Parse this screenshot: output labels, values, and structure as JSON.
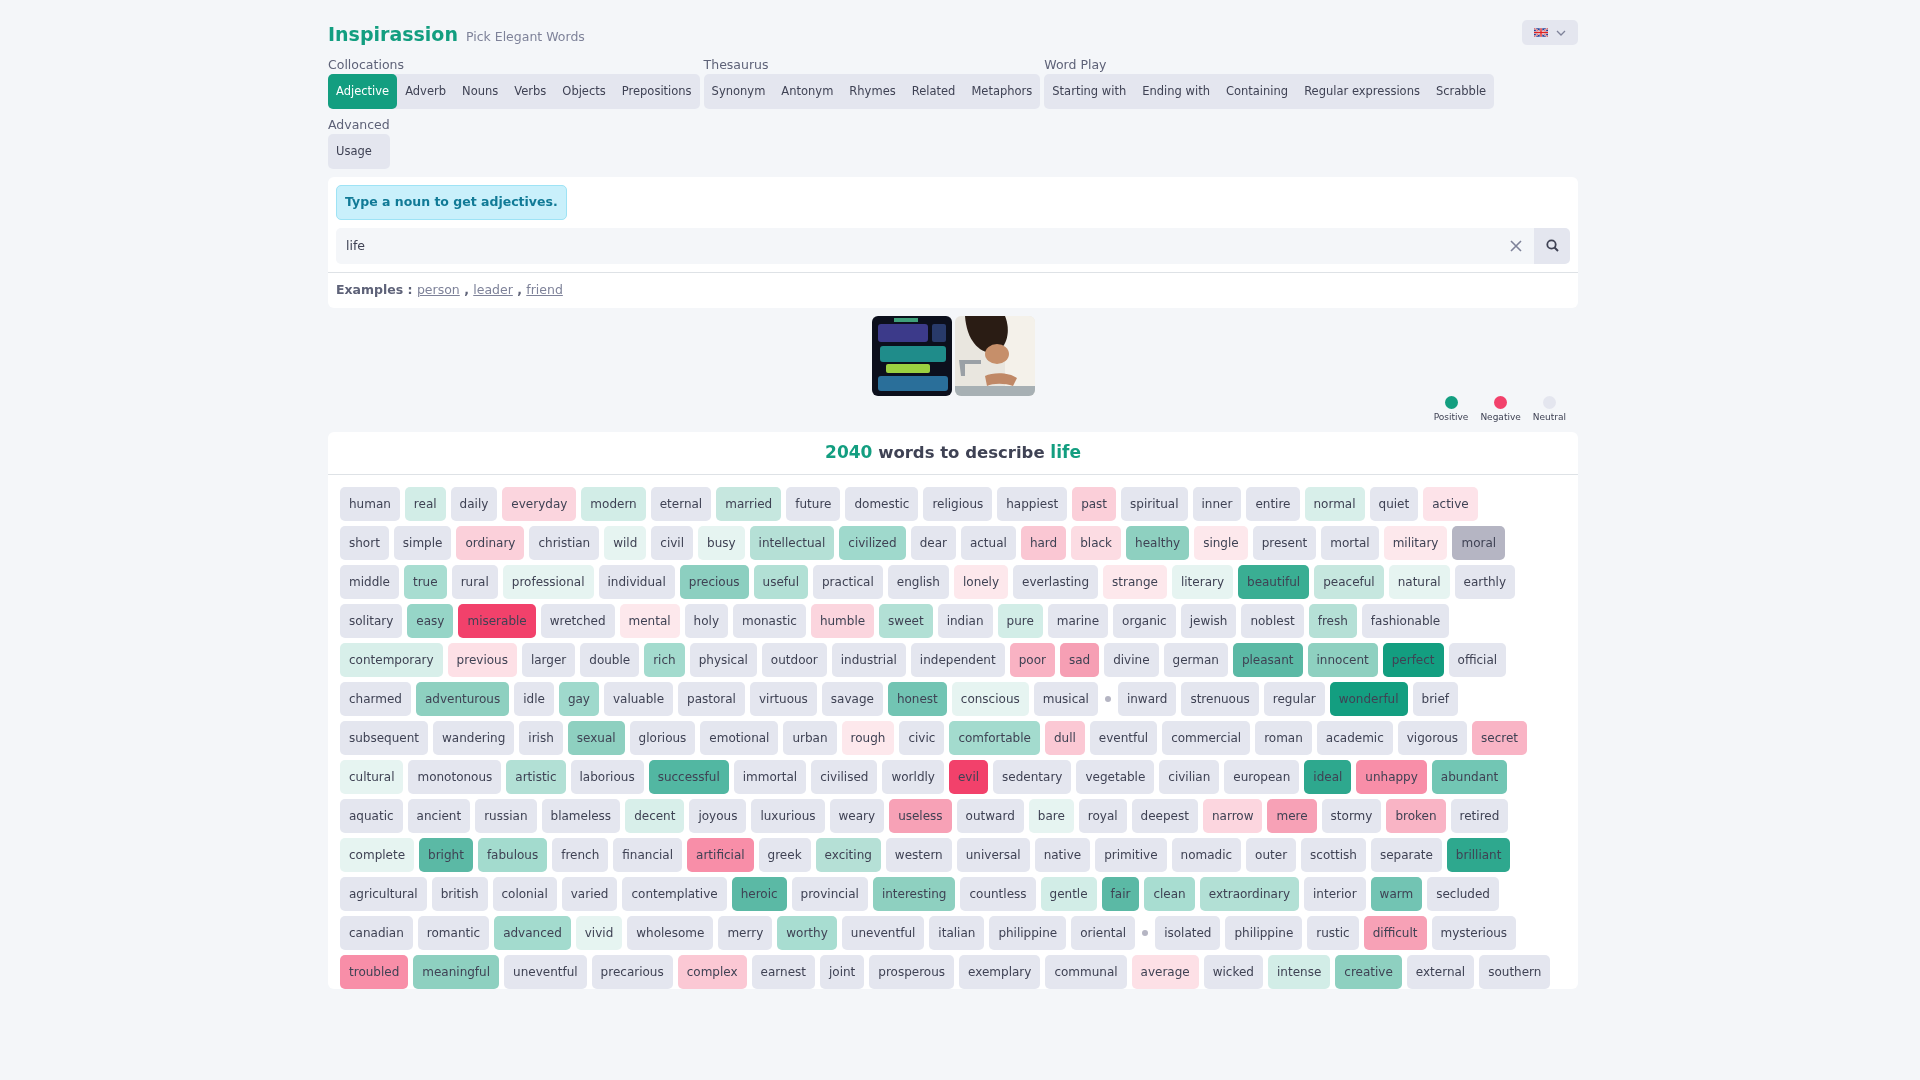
{
  "brand": {
    "name": "Inspirassion",
    "tagline": "Pick Elegant Words"
  },
  "tab_groups": [
    {
      "label": "Collocations",
      "tabs": [
        {
          "label": "Adjective",
          "selected": true
        },
        {
          "label": "Adverb",
          "selected": false
        },
        {
          "label": "Nouns",
          "selected": false
        },
        {
          "label": "Verbs",
          "selected": false
        },
        {
          "label": "Objects",
          "selected": false
        },
        {
          "label": "Prepositions",
          "selected": false
        }
      ]
    },
    {
      "label": "Thesaurus",
      "tabs": [
        {
          "label": "Synonym",
          "selected": false
        },
        {
          "label": "Antonym",
          "selected": false
        },
        {
          "label": "Rhymes",
          "selected": false
        },
        {
          "label": "Related",
          "selected": false
        },
        {
          "label": "Metaphors",
          "selected": false
        }
      ]
    },
    {
      "label": "Word Play",
      "tabs": [
        {
          "label": "Starting with",
          "selected": false
        },
        {
          "label": "Ending with",
          "selected": false
        },
        {
          "label": "Containing",
          "selected": false
        },
        {
          "label": "Regular expressions",
          "selected": false
        },
        {
          "label": "Scrabble",
          "selected": false
        }
      ]
    },
    {
      "label": "Advanced",
      "tabs": [
        {
          "label": "Usage",
          "selected": false
        }
      ]
    }
  ],
  "search": {
    "hint": "Type a noun to get adjectives.",
    "value": "life",
    "examples_label": "Examples :",
    "separator": ",",
    "examples": [
      "person",
      "leader",
      "friend"
    ]
  },
  "legend": [
    {
      "label": "Positive",
      "color": "#139e80"
    },
    {
      "label": "Negative",
      "color": "#f2416b"
    },
    {
      "label": "Neutral",
      "color": "#e4e6ef"
    }
  ],
  "results": {
    "count": "2040",
    "phrase": "words to describe",
    "term": "life",
    "rows": [
      [
        {
          "kind": "word",
          "text": "human",
          "color": "#e4e6ef"
        },
        {
          "kind": "word",
          "text": "real",
          "color": "#d2ede7"
        },
        {
          "kind": "word",
          "text": "daily",
          "color": "#e4e6ef"
        },
        {
          "kind": "word",
          "text": "everyday",
          "color": "#fbd5de"
        },
        {
          "kind": "word",
          "text": "modern",
          "color": "#d2ede7"
        },
        {
          "kind": "word",
          "text": "eternal",
          "color": "#e4e6ef"
        },
        {
          "kind": "word",
          "text": "married",
          "color": "#c6e7df"
        },
        {
          "kind": "word",
          "text": "future",
          "color": "#e4e6ef"
        },
        {
          "kind": "word",
          "text": "domestic",
          "color": "#e4e6ef"
        },
        {
          "kind": "word",
          "text": "religious",
          "color": "#e4e6ef"
        },
        {
          "kind": "word",
          "text": "happiest",
          "color": "#e4e6ef"
        },
        {
          "kind": "word",
          "text": "past",
          "color": "#fbcfd9"
        },
        {
          "kind": "word",
          "text": "spiritual",
          "color": "#e4e6ef"
        },
        {
          "kind": "word",
          "text": "inner",
          "color": "#e4e6ef"
        },
        {
          "kind": "word",
          "text": "entire",
          "color": "#e4e6ef"
        },
        {
          "kind": "word",
          "text": "normal",
          "color": "#d8efea"
        },
        {
          "kind": "word",
          "text": "quiet",
          "color": "#e4e6ef"
        },
        {
          "kind": "word",
          "text": "active",
          "color": "#fde3e9"
        }
      ],
      [
        {
          "kind": "word",
          "text": "short",
          "color": "#e4e6ef"
        },
        {
          "kind": "word",
          "text": "simple",
          "color": "#e4e6ef"
        },
        {
          "kind": "word",
          "text": "ordinary",
          "color": "#fbd0da"
        },
        {
          "kind": "word",
          "text": "christian",
          "color": "#e4e6ef"
        },
        {
          "kind": "word",
          "text": "wild",
          "color": "#e6f4f1"
        },
        {
          "kind": "word",
          "text": "civil",
          "color": "#e4e6ef"
        },
        {
          "kind": "word",
          "text": "busy",
          "color": "#e6f4f1"
        },
        {
          "kind": "word",
          "text": "intellectual",
          "color": "#b5e0d6"
        },
        {
          "kind": "word",
          "text": "civilized",
          "color": "#9fd9cc"
        },
        {
          "kind": "word",
          "text": "dear",
          "color": "#e4e6ef"
        },
        {
          "kind": "word",
          "text": "actual",
          "color": "#e4e6ef"
        },
        {
          "kind": "word",
          "text": "hard",
          "color": "#fac7d3"
        },
        {
          "kind": "word",
          "text": "black",
          "color": "#fcdce3"
        },
        {
          "kind": "word",
          "text": "healthy",
          "color": "#8ed0c0"
        },
        {
          "kind": "word",
          "text": "single",
          "color": "#fde8ec"
        },
        {
          "kind": "word",
          "text": "present",
          "color": "#e4e6ef"
        },
        {
          "kind": "word",
          "text": "mortal",
          "color": "#e4e6ef"
        },
        {
          "kind": "word",
          "text": "military",
          "color": "#fde8ec"
        },
        {
          "kind": "word",
          "text": "moral",
          "color": "#b5b5c3"
        }
      ],
      [
        {
          "kind": "word",
          "text": "middle",
          "color": "#e4e6ef"
        },
        {
          "kind": "word",
          "text": "true",
          "color": "#a8ddd1"
        },
        {
          "kind": "word",
          "text": "rural",
          "color": "#e4e6ef"
        },
        {
          "kind": "word",
          "text": "professional",
          "color": "#e6f4f1"
        },
        {
          "kind": "word",
          "text": "individual",
          "color": "#e4e6ef"
        },
        {
          "kind": "word",
          "text": "precious",
          "color": "#8ccfc0"
        },
        {
          "kind": "word",
          "text": "useful",
          "color": "#b2e0d5"
        },
        {
          "kind": "word",
          "text": "practical",
          "color": "#e4e6ef"
        },
        {
          "kind": "word",
          "text": "english",
          "color": "#e4e6ef"
        },
        {
          "kind": "word",
          "text": "lonely",
          "color": "#fde8ec"
        },
        {
          "kind": "word",
          "text": "everlasting",
          "color": "#e4e6ef"
        },
        {
          "kind": "word",
          "text": "strange",
          "color": "#fde8ec"
        },
        {
          "kind": "word",
          "text": "literary",
          "color": "#e6f4f1"
        },
        {
          "kind": "word",
          "text": "beautiful",
          "color": "#3aae93"
        },
        {
          "kind": "word",
          "text": "peaceful",
          "color": "#c6e7df"
        },
        {
          "kind": "word",
          "text": "natural",
          "color": "#e6f4f1"
        },
        {
          "kind": "word",
          "text": "earthly",
          "color": "#e4e6ef"
        }
      ],
      [
        {
          "kind": "word",
          "text": "solitary",
          "color": "#e4e6ef"
        },
        {
          "kind": "word",
          "text": "easy",
          "color": "#96d5c7"
        },
        {
          "kind": "word",
          "text": "miserable",
          "color": "#f2416b"
        },
        {
          "kind": "word",
          "text": "wretched",
          "color": "#e4e6ef"
        },
        {
          "kind": "word",
          "text": "mental",
          "color": "#fde8ec"
        },
        {
          "kind": "word",
          "text": "holy",
          "color": "#e4e6ef"
        },
        {
          "kind": "word",
          "text": "monastic",
          "color": "#e4e6ef"
        },
        {
          "kind": "word",
          "text": "humble",
          "color": "#fbd5de"
        },
        {
          "kind": "word",
          "text": "sweet",
          "color": "#b2e0d5"
        },
        {
          "kind": "word",
          "text": "indian",
          "color": "#e4e6ef"
        },
        {
          "kind": "word",
          "text": "pure",
          "color": "#d2ede7"
        },
        {
          "kind": "word",
          "text": "marine",
          "color": "#e4e6ef"
        },
        {
          "kind": "word",
          "text": "organic",
          "color": "#e4e6ef"
        },
        {
          "kind": "word",
          "text": "jewish",
          "color": "#e4e6ef"
        },
        {
          "kind": "word",
          "text": "noblest",
          "color": "#e4e6ef"
        },
        {
          "kind": "word",
          "text": "fresh",
          "color": "#b5e0d6"
        },
        {
          "kind": "word",
          "text": "fashionable",
          "color": "#e4e6ef"
        }
      ],
      [
        {
          "kind": "word",
          "text": "contemporary",
          "color": "#d8efea"
        },
        {
          "kind": "word",
          "text": "previous",
          "color": "#fde0e6"
        },
        {
          "kind": "word",
          "text": "larger",
          "color": "#e4e6ef"
        },
        {
          "kind": "word",
          "text": "double",
          "color": "#e4e6ef"
        },
        {
          "kind": "word",
          "text": "rich",
          "color": "#a3dbce"
        },
        {
          "kind": "word",
          "text": "physical",
          "color": "#e4e6ef"
        },
        {
          "kind": "word",
          "text": "outdoor",
          "color": "#e4e6ef"
        },
        {
          "kind": "word",
          "text": "industrial",
          "color": "#e4e6ef"
        },
        {
          "kind": "word",
          "text": "independent",
          "color": "#e4e6ef"
        },
        {
          "kind": "word",
          "text": "poor",
          "color": "#f9b2c3"
        },
        {
          "kind": "word",
          "text": "sad",
          "color": "#f69fb4"
        },
        {
          "kind": "word",
          "text": "divine",
          "color": "#e4e6ef"
        },
        {
          "kind": "word",
          "text": "german",
          "color": "#e4e6ef"
        },
        {
          "kind": "word",
          "text": "pleasant",
          "color": "#5bb9a5"
        },
        {
          "kind": "word",
          "text": "innocent",
          "color": "#8ed0c0"
        },
        {
          "kind": "word",
          "text": "perfect",
          "color": "#139e80"
        },
        {
          "kind": "word",
          "text": "official",
          "color": "#e4e6ef"
        }
      ],
      [
        {
          "kind": "word",
          "text": "charmed",
          "color": "#e4e6ef"
        },
        {
          "kind": "word",
          "text": "adventurous",
          "color": "#8ed0c0"
        },
        {
          "kind": "word",
          "text": "idle",
          "color": "#e4e6ef"
        },
        {
          "kind": "word",
          "text": "gay",
          "color": "#9fd9cc"
        },
        {
          "kind": "word",
          "text": "valuable",
          "color": "#e4e6ef"
        },
        {
          "kind": "word",
          "text": "pastoral",
          "color": "#e4e6ef"
        },
        {
          "kind": "word",
          "text": "virtuous",
          "color": "#e4e6ef"
        },
        {
          "kind": "word",
          "text": "savage",
          "color": "#e4e6ef"
        },
        {
          "kind": "word",
          "text": "honest",
          "color": "#72c4b3"
        },
        {
          "kind": "word",
          "text": "conscious",
          "color": "#e6f4f1"
        },
        {
          "kind": "word",
          "text": "musical",
          "color": "#e4e6ef"
        },
        {
          "kind": "dot"
        },
        {
          "kind": "word",
          "text": "inward",
          "color": "#e4e6ef"
        },
        {
          "kind": "word",
          "text": "strenuous",
          "color": "#e4e6ef"
        },
        {
          "kind": "word",
          "text": "regular",
          "color": "#e4e6ef"
        },
        {
          "kind": "word",
          "text": "wonderful",
          "color": "#139e80"
        },
        {
          "kind": "word",
          "text": "brief",
          "color": "#e4e6ef"
        }
      ],
      [
        {
          "kind": "word",
          "text": "subsequent",
          "color": "#e4e6ef"
        },
        {
          "kind": "word",
          "text": "wandering",
          "color": "#e4e6ef"
        },
        {
          "kind": "word",
          "text": "irish",
          "color": "#e4e6ef"
        },
        {
          "kind": "word",
          "text": "sexual",
          "color": "#8ed0c0"
        },
        {
          "kind": "word",
          "text": "glorious",
          "color": "#e4e6ef"
        },
        {
          "kind": "word",
          "text": "emotional",
          "color": "#e4e6ef"
        },
        {
          "kind": "word",
          "text": "urban",
          "color": "#e4e6ef"
        },
        {
          "kind": "word",
          "text": "rough",
          "color": "#fde8ec"
        },
        {
          "kind": "word",
          "text": "civic",
          "color": "#e4e6ef"
        },
        {
          "kind": "word",
          "text": "comfortable",
          "color": "#a3dbce"
        },
        {
          "kind": "word",
          "text": "dull",
          "color": "#fbc8d4"
        },
        {
          "kind": "word",
          "text": "eventful",
          "color": "#e4e6ef"
        },
        {
          "kind": "word",
          "text": "commercial",
          "color": "#e4e6ef"
        },
        {
          "kind": "word",
          "text": "roman",
          "color": "#e4e6ef"
        },
        {
          "kind": "word",
          "text": "academic",
          "color": "#e4e6ef"
        },
        {
          "kind": "word",
          "text": "vigorous",
          "color": "#e4e6ef"
        },
        {
          "kind": "word",
          "text": "secret",
          "color": "#f9b4c5"
        }
      ],
      [
        {
          "kind": "word",
          "text": "cultural",
          "color": "#e6f4f1"
        },
        {
          "kind": "word",
          "text": "monotonous",
          "color": "#e4e6ef"
        },
        {
          "kind": "word",
          "text": "artistic",
          "color": "#b2e0d5"
        },
        {
          "kind": "word",
          "text": "laborious",
          "color": "#e4e6ef"
        },
        {
          "kind": "word",
          "text": "successful",
          "color": "#52b7a2"
        },
        {
          "kind": "word",
          "text": "immortal",
          "color": "#e4e6ef"
        },
        {
          "kind": "word",
          "text": "civilised",
          "color": "#e4e6ef"
        },
        {
          "kind": "word",
          "text": "worldly",
          "color": "#e4e6ef"
        },
        {
          "kind": "word",
          "text": "evil",
          "color": "#f2416b"
        },
        {
          "kind": "word",
          "text": "sedentary",
          "color": "#e4e6ef"
        },
        {
          "kind": "word",
          "text": "vegetable",
          "color": "#e4e6ef"
        },
        {
          "kind": "word",
          "text": "civilian",
          "color": "#e4e6ef"
        },
        {
          "kind": "word",
          "text": "european",
          "color": "#e4e6ef"
        },
        {
          "kind": "word",
          "text": "ideal",
          "color": "#2ea88e"
        },
        {
          "kind": "word",
          "text": "unhappy",
          "color": "#f88ea8"
        },
        {
          "kind": "word",
          "text": "abundant",
          "color": "#72c6b4"
        }
      ],
      [
        {
          "kind": "word",
          "text": "aquatic",
          "color": "#e4e6ef"
        },
        {
          "kind": "word",
          "text": "ancient",
          "color": "#e4e6ef"
        },
        {
          "kind": "word",
          "text": "russian",
          "color": "#e4e6ef"
        },
        {
          "kind": "word",
          "text": "blameless",
          "color": "#e4e6ef"
        },
        {
          "kind": "word",
          "text": "decent",
          "color": "#d8efea"
        },
        {
          "kind": "word",
          "text": "joyous",
          "color": "#e4e6ef"
        },
        {
          "kind": "word",
          "text": "luxurious",
          "color": "#e4e6ef"
        },
        {
          "kind": "word",
          "text": "weary",
          "color": "#e4e6ef"
        },
        {
          "kind": "word",
          "text": "useless",
          "color": "#f7a1b6"
        },
        {
          "kind": "word",
          "text": "outward",
          "color": "#e4e6ef"
        },
        {
          "kind": "word",
          "text": "bare",
          "color": "#e6f4f1"
        },
        {
          "kind": "word",
          "text": "royal",
          "color": "#e4e6ef"
        },
        {
          "kind": "word",
          "text": "deepest",
          "color": "#e4e6ef"
        },
        {
          "kind": "word",
          "text": "narrow",
          "color": "#fcd6df"
        },
        {
          "kind": "word",
          "text": "mere",
          "color": "#f7a1b6"
        },
        {
          "kind": "word",
          "text": "stormy",
          "color": "#e4e6ef"
        },
        {
          "kind": "word",
          "text": "broken",
          "color": "#f9b4c5"
        },
        {
          "kind": "word",
          "text": "retired",
          "color": "#e4e6ef"
        }
      ],
      [
        {
          "kind": "word",
          "text": "complete",
          "color": "#e6f4f1"
        },
        {
          "kind": "word",
          "text": "bright",
          "color": "#5bb9a5"
        },
        {
          "kind": "word",
          "text": "fabulous",
          "color": "#a3dbce"
        },
        {
          "kind": "word",
          "text": "french",
          "color": "#e4e6ef"
        },
        {
          "kind": "word",
          "text": "financial",
          "color": "#e4e6ef"
        },
        {
          "kind": "word",
          "text": "artificial",
          "color": "#f88ea8"
        },
        {
          "kind": "word",
          "text": "greek",
          "color": "#e4e6ef"
        },
        {
          "kind": "word",
          "text": "exciting",
          "color": "#b5e0d6"
        },
        {
          "kind": "word",
          "text": "western",
          "color": "#e4e6ef"
        },
        {
          "kind": "word",
          "text": "universal",
          "color": "#e4e6ef"
        },
        {
          "kind": "word",
          "text": "native",
          "color": "#e4e6ef"
        },
        {
          "kind": "word",
          "text": "primitive",
          "color": "#e4e6ef"
        },
        {
          "kind": "word",
          "text": "nomadic",
          "color": "#e4e6ef"
        },
        {
          "kind": "word",
          "text": "outer",
          "color": "#e4e6ef"
        },
        {
          "kind": "word",
          "text": "scottish",
          "color": "#e4e6ef"
        },
        {
          "kind": "word",
          "text": "separate",
          "color": "#e4e6ef"
        },
        {
          "kind": "word",
          "text": "brilliant",
          "color": "#2ea88e"
        }
      ],
      [
        {
          "kind": "word",
          "text": "agricultural",
          "color": "#e4e6ef"
        },
        {
          "kind": "word",
          "text": "british",
          "color": "#e4e6ef"
        },
        {
          "kind": "word",
          "text": "colonial",
          "color": "#e4e6ef"
        },
        {
          "kind": "word",
          "text": "varied",
          "color": "#e4e6ef"
        },
        {
          "kind": "word",
          "text": "contemplative",
          "color": "#e4e6ef"
        },
        {
          "kind": "word",
          "text": "heroic",
          "color": "#5bb9a5"
        },
        {
          "kind": "word",
          "text": "provincial",
          "color": "#e4e6ef"
        },
        {
          "kind": "word",
          "text": "interesting",
          "color": "#8ed0c0"
        },
        {
          "kind": "word",
          "text": "countless",
          "color": "#e4e6ef"
        },
        {
          "kind": "word",
          "text": "gentle",
          "color": "#d2ede7"
        },
        {
          "kind": "word",
          "text": "fair",
          "color": "#5bb9a5"
        },
        {
          "kind": "word",
          "text": "clean",
          "color": "#a8ddd1"
        },
        {
          "kind": "word",
          "text": "extraordinary",
          "color": "#b2e0d5"
        },
        {
          "kind": "word",
          "text": "interior",
          "color": "#e4e6ef"
        },
        {
          "kind": "word",
          "text": "warm",
          "color": "#72c4b3"
        },
        {
          "kind": "word",
          "text": "secluded",
          "color": "#e4e6ef"
        }
      ],
      [
        {
          "kind": "word",
          "text": "canadian",
          "color": "#e4e6ef"
        },
        {
          "kind": "word",
          "text": "romantic",
          "color": "#e4e6ef"
        },
        {
          "kind": "word",
          "text": "advanced",
          "color": "#a3dbce"
        },
        {
          "kind": "word",
          "text": "vivid",
          "color": "#e6f4f1"
        },
        {
          "kind": "word",
          "text": "wholesome",
          "color": "#e4e6ef"
        },
        {
          "kind": "word",
          "text": "merry",
          "color": "#e4e6ef"
        },
        {
          "kind": "word",
          "text": "worthy",
          "color": "#a8ddd1"
        },
        {
          "kind": "word",
          "text": "uneventful",
          "color": "#e4e6ef"
        },
        {
          "kind": "word",
          "text": "italian",
          "color": "#e4e6ef"
        },
        {
          "kind": "word",
          "text": "philippine",
          "color": "#e4e6ef"
        },
        {
          "kind": "word",
          "text": "oriental",
          "color": "#e4e6ef"
        },
        {
          "kind": "dot"
        },
        {
          "kind": "word",
          "text": "isolated",
          "color": "#e4e6ef"
        },
        {
          "kind": "word",
          "text": "philippine",
          "color": "#e4e6ef"
        },
        {
          "kind": "word",
          "text": "rustic",
          "color": "#e4e6ef"
        },
        {
          "kind": "word",
          "text": "difficult",
          "color": "#f7a1b6"
        },
        {
          "kind": "word",
          "text": "mysterious",
          "color": "#e4e6ef"
        }
      ],
      [
        {
          "kind": "word",
          "text": "troubled",
          "color": "#f88ea8"
        },
        {
          "kind": "word",
          "text": "meaningful",
          "color": "#8ed0c0"
        },
        {
          "kind": "word",
          "text": "uneventful",
          "color": "#e4e6ef"
        },
        {
          "kind": "word",
          "text": "precarious",
          "color": "#e4e6ef"
        },
        {
          "kind": "word",
          "text": "complex",
          "color": "#fbc8d4"
        },
        {
          "kind": "word",
          "text": "earnest",
          "color": "#e4e6ef"
        },
        {
          "kind": "word",
          "text": "joint",
          "color": "#e4e6ef"
        },
        {
          "kind": "word",
          "text": "prosperous",
          "color": "#e4e6ef"
        },
        {
          "kind": "word",
          "text": "exemplary",
          "color": "#e4e6ef"
        },
        {
          "kind": "word",
          "text": "communal",
          "color": "#e4e6ef"
        },
        {
          "kind": "word",
          "text": "average",
          "color": "#fde0e6"
        },
        {
          "kind": "word",
          "text": "wicked",
          "color": "#e4e6ef"
        },
        {
          "kind": "word",
          "text": "intense",
          "color": "#d2ede7"
        },
        {
          "kind": "word",
          "text": "creative",
          "color": "#8ed0c0"
        },
        {
          "kind": "word",
          "text": "external",
          "color": "#e4e6ef"
        },
        {
          "kind": "word",
          "text": "southern",
          "color": "#e4e6ef"
        }
      ]
    ]
  }
}
